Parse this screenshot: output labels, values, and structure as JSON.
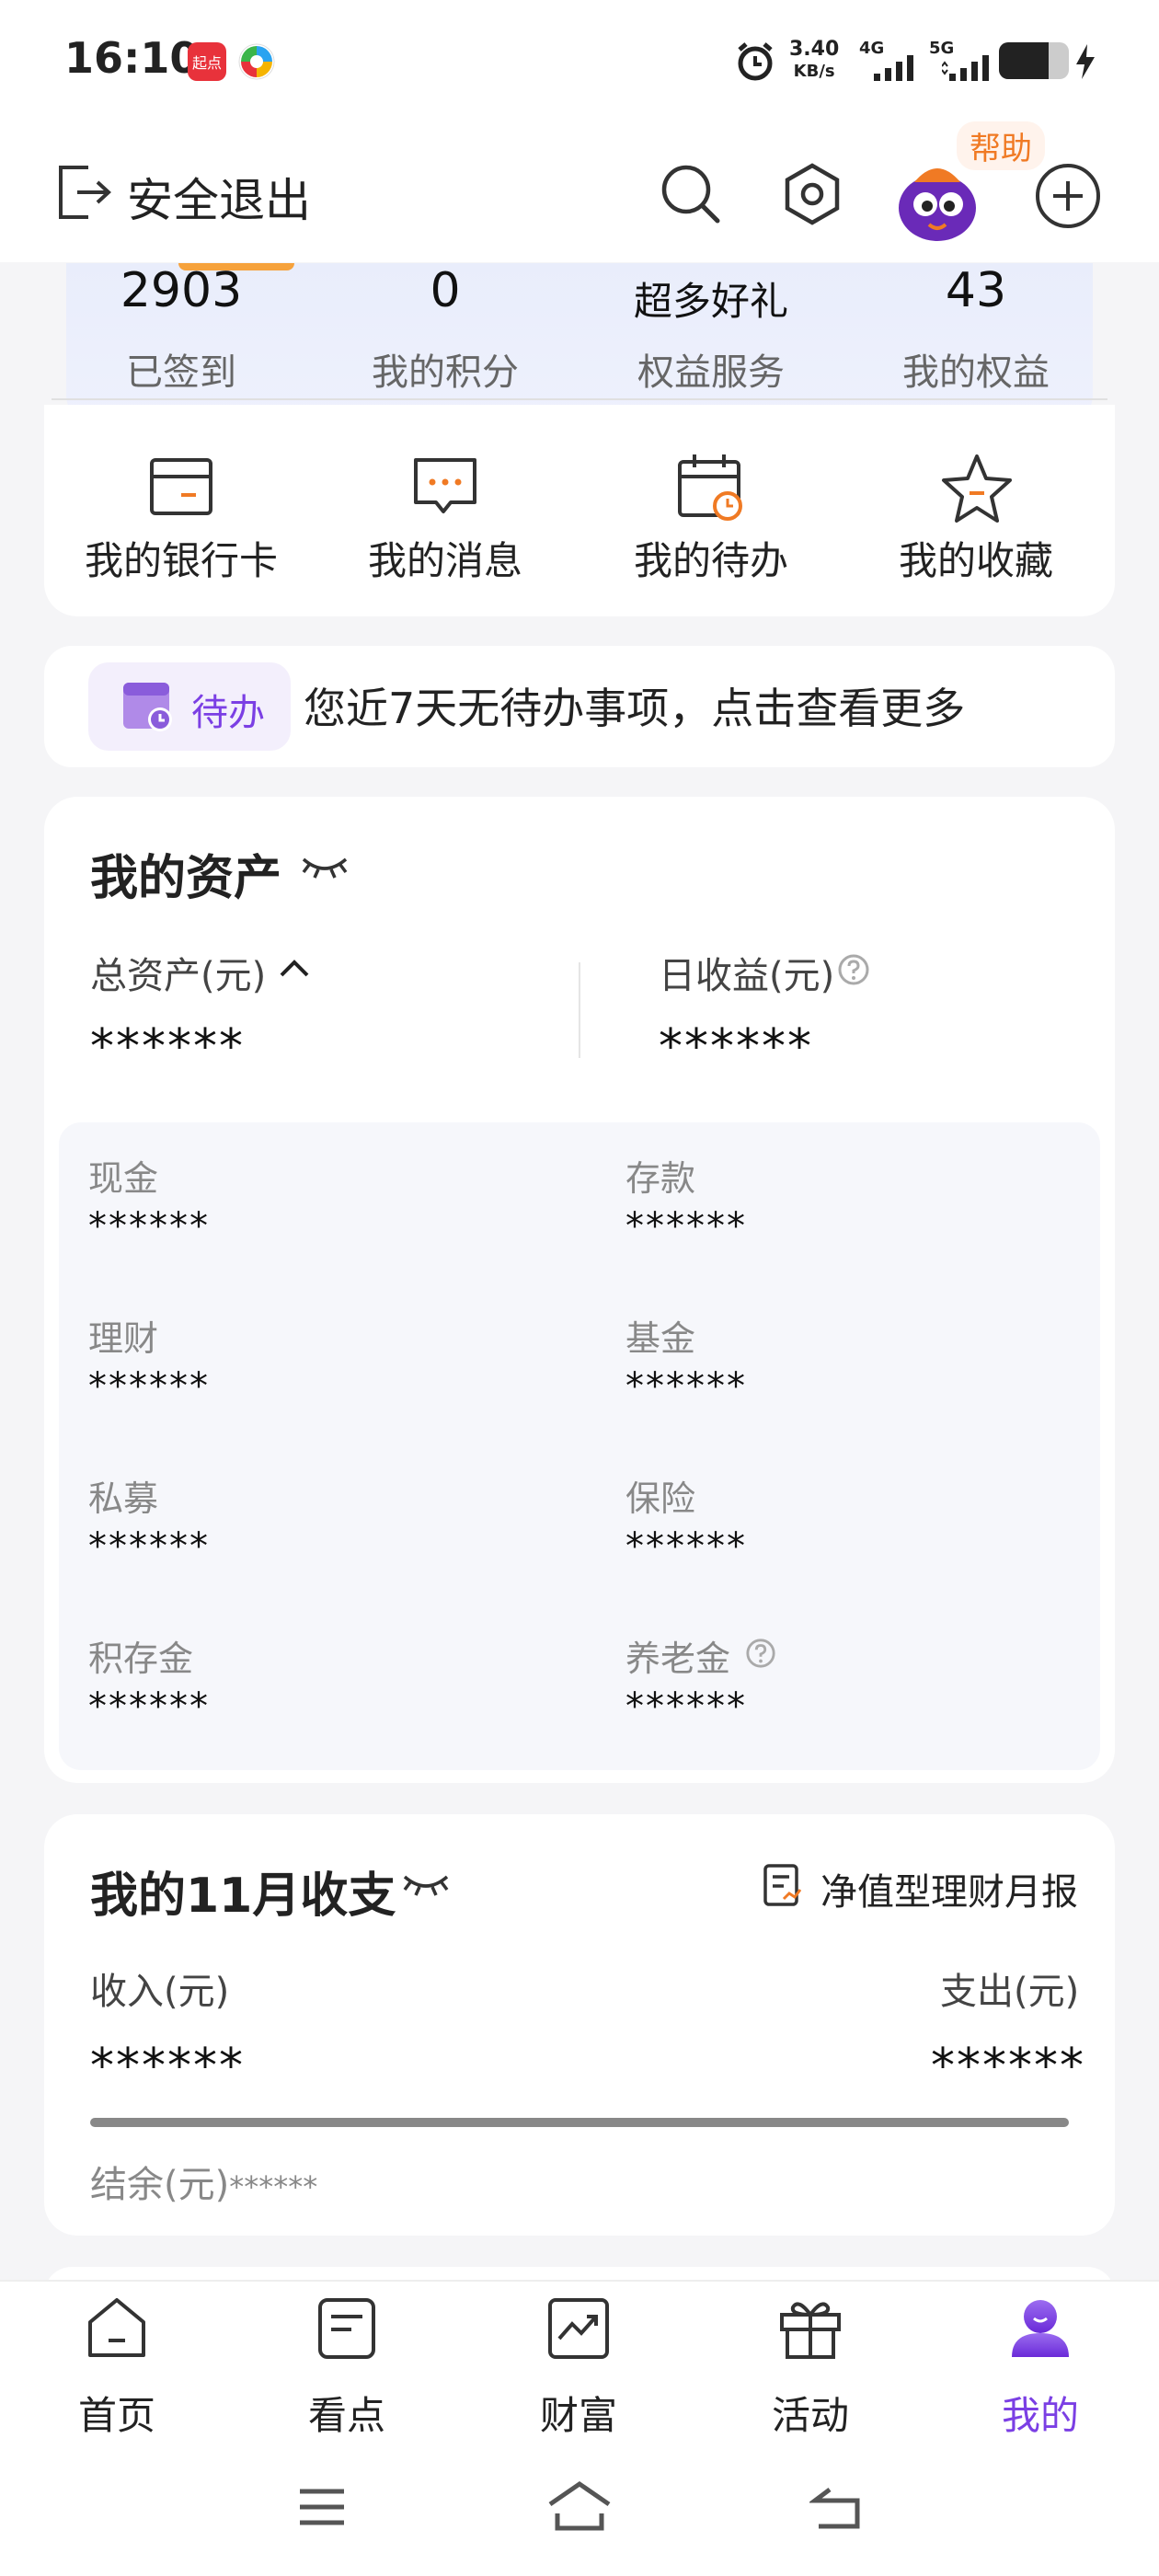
{
  "status_bar": {
    "time": "16:10",
    "app_badge_1": "起点",
    "network_speed": "3.40",
    "network_speed_unit": "KB/s",
    "net1": "4G",
    "net2": "5G"
  },
  "header": {
    "exit_label": "安全退出",
    "help_label": "帮助"
  },
  "benefits": [
    {
      "value": "2903",
      "label": "已签到"
    },
    {
      "value": "0",
      "label": "我的积分"
    },
    {
      "value": "超多好礼",
      "label": "权益服务"
    },
    {
      "value": "43",
      "label": "我的权益"
    }
  ],
  "quick_actions": [
    {
      "label": "我的银行卡",
      "icon": "bank-card-icon"
    },
    {
      "label": "我的消息",
      "icon": "message-icon"
    },
    {
      "label": "我的待办",
      "icon": "calendar-icon"
    },
    {
      "label": "我的收藏",
      "icon": "star-icon"
    }
  ],
  "todo": {
    "chip_label": "待办",
    "text": "您近7天无待办事项，点击查看更多"
  },
  "assets": {
    "title": "我的资产",
    "total_label": "总资产(元)",
    "total_value": "******",
    "daily_label": "日收益(元)",
    "daily_value": "******",
    "categories": [
      {
        "label": "现金",
        "value": "******"
      },
      {
        "label": "存款",
        "value": "******"
      },
      {
        "label": "理财",
        "value": "******"
      },
      {
        "label": "基金",
        "value": "******"
      },
      {
        "label": "私募",
        "value": "******"
      },
      {
        "label": "保险",
        "value": "******"
      },
      {
        "label": "积存金",
        "value": "******"
      },
      {
        "label": "养老金",
        "value": "******"
      }
    ]
  },
  "income": {
    "title": "我的11月收支",
    "report_link": "净值型理财月报",
    "income_label": "收入(元)",
    "income_value": "******",
    "expense_label": "支出(元)",
    "expense_value": "******",
    "balance_label": "结余(元)",
    "balance_value": "******"
  },
  "bottom_nav": [
    {
      "label": "首页",
      "icon": "home-icon",
      "active": false
    },
    {
      "label": "看点",
      "icon": "article-icon",
      "active": false
    },
    {
      "label": "财富",
      "icon": "chart-icon",
      "active": false
    },
    {
      "label": "活动",
      "icon": "gift-icon",
      "active": false
    },
    {
      "label": "我的",
      "icon": "profile-icon",
      "active": true
    }
  ],
  "colors": {
    "accent": "#7b3fe4",
    "orange": "#f07a24",
    "banner": "#eef1fd"
  }
}
